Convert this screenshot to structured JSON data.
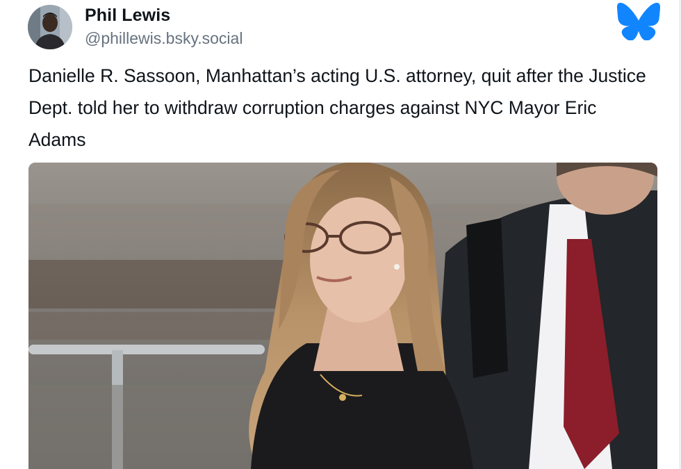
{
  "author": {
    "display_name": "Phil Lewis",
    "handle": "@phillewis.bsky.social",
    "avatar_icon": "profile-avatar"
  },
  "platform": {
    "logo_icon": "bluesky-butterfly-icon",
    "brand_color": "#1185fe"
  },
  "post": {
    "text": "Danielle R. Sassoon, Manhattan’s acting U.S. attorney, quit after the Justice Dept. told her to withdraw corruption charges against NYC Mayor Eric Adams"
  },
  "colors": {
    "text_primary": "#0f1419",
    "text_secondary": "#66727f"
  }
}
